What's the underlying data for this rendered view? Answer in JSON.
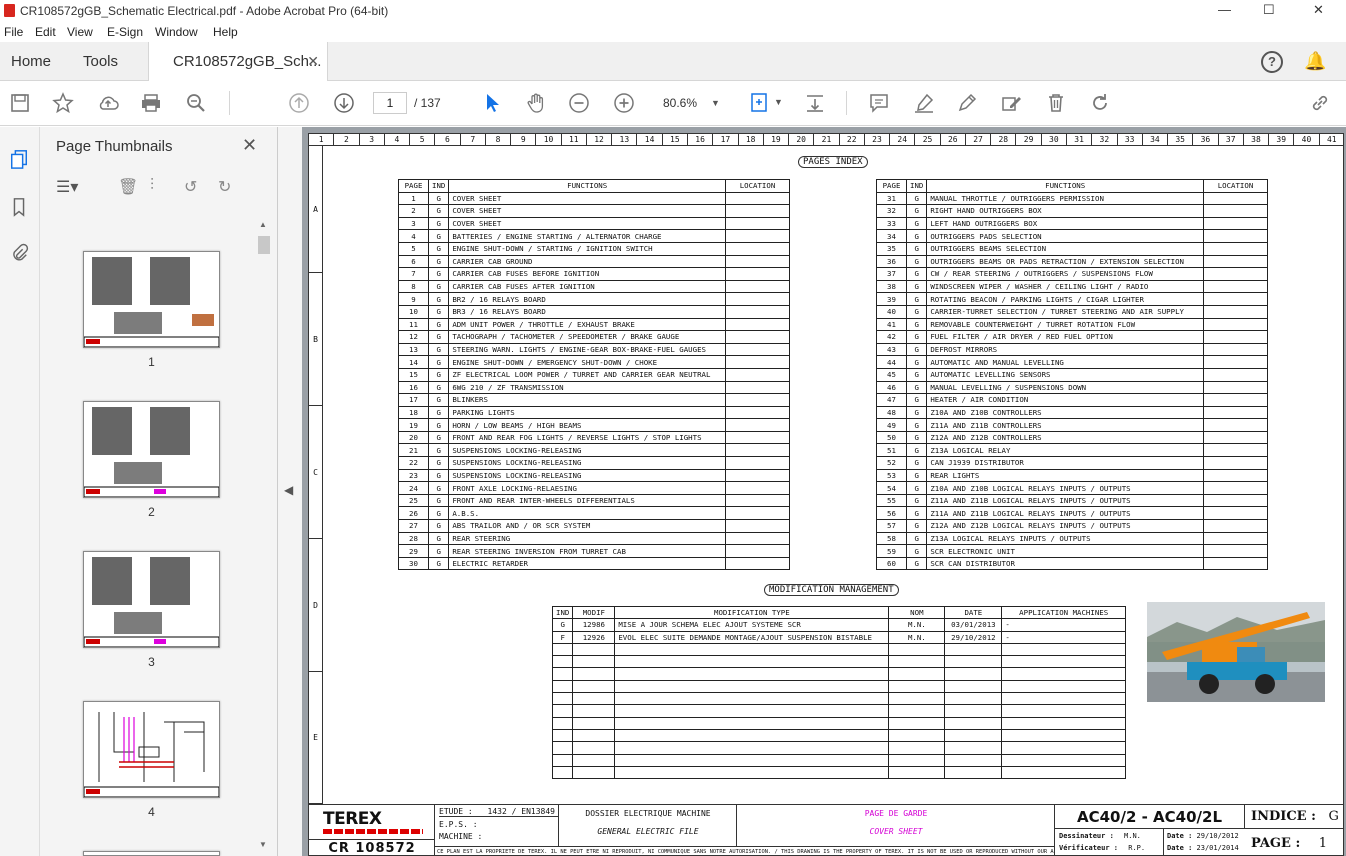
{
  "window": {
    "title": "CR108572gGB_Schematic Electrical.pdf - Adobe Acrobat Pro (64-bit)",
    "controls": [
      "—",
      "☐",
      "✕"
    ]
  },
  "menu": [
    "File",
    "Edit",
    "View",
    "E-Sign",
    "Window",
    "Help"
  ],
  "tabs": {
    "home": "Home",
    "tools": "Tools",
    "doc": "CR108572gGB_Sch...",
    "doc_close": "✕"
  },
  "toolbar": {
    "page_current": "1",
    "page_total": "/ 137",
    "zoom": "80.6%"
  },
  "panel": {
    "title": "Page Thumbnails",
    "close": "✕",
    "thumbs": [
      "1",
      "2",
      "3",
      "4"
    ]
  },
  "sheet": {
    "columns": [
      "1",
      "2",
      "3",
      "4",
      "5",
      "6",
      "7",
      "8",
      "9",
      "10",
      "11",
      "12",
      "13",
      "14",
      "15",
      "16",
      "17",
      "18",
      "19",
      "20",
      "21",
      "22",
      "23",
      "24",
      "25",
      "26",
      "27",
      "28",
      "29",
      "30",
      "31",
      "32",
      "33",
      "34",
      "35",
      "36",
      "37",
      "38",
      "39",
      "40",
      "41"
    ],
    "rows": [
      "A",
      "B",
      "C",
      "D",
      "E"
    ],
    "pages_index_title": "PAGES INDEX",
    "index_headers": {
      "page": "PAGE",
      "ind": "IND",
      "functions": "FUNCTIONS",
      "location": "LOCATION"
    },
    "left_index": [
      [
        "1",
        "G",
        "COVER SHEET"
      ],
      [
        "2",
        "G",
        "COVER SHEET"
      ],
      [
        "3",
        "G",
        "COVER SHEET"
      ],
      [
        "4",
        "G",
        "BATTERIES / ENGINE STARTING / ALTERNATOR CHARGE"
      ],
      [
        "5",
        "G",
        "ENGINE SHUT-DOWN / STARTING / IGNITION SWITCH"
      ],
      [
        "6",
        "G",
        "CARRIER CAB GROUND"
      ],
      [
        "7",
        "G",
        "CARRIER CAB FUSES BEFORE IGNITION"
      ],
      [
        "8",
        "G",
        "CARRIER CAB FUSES AFTER IGNITION"
      ],
      [
        "9",
        "G",
        "BR2 / 16 RELAYS BOARD"
      ],
      [
        "10",
        "G",
        "BR3 / 16 RELAYS BOARD"
      ],
      [
        "11",
        "G",
        "ADM UNIT POWER / THROTTLE / EXHAUST BRAKE"
      ],
      [
        "12",
        "G",
        "TACHOGRAPH / TACHOMETER / SPEEDOMETER / BRAKE GAUGE"
      ],
      [
        "13",
        "G",
        "STEERING WARN. LIGHTS / ENGINE-GEAR BOX-BRAKE-FUEL GAUGES"
      ],
      [
        "14",
        "G",
        "ENGINE SHUT-DOWN / EMERGENCY SHUT-DOWN / CHOKE"
      ],
      [
        "15",
        "G",
        "ZF ELECTRICAL LOOM POWER / TURRET AND CARRIER GEAR NEUTRAL"
      ],
      [
        "16",
        "G",
        "6WG 210 / ZF TRANSMISSION"
      ],
      [
        "17",
        "G",
        "BLINKERS"
      ],
      [
        "18",
        "G",
        "PARKING LIGHTS"
      ],
      [
        "19",
        "G",
        "HORN / LOW BEAMS / HIGH BEAMS"
      ],
      [
        "20",
        "G",
        "FRONT AND REAR FOG LIGHTS / REVERSE LIGHTS / STOP LIGHTS"
      ],
      [
        "21",
        "G",
        "SUSPENSIONS LOCKING-RELEASING"
      ],
      [
        "22",
        "G",
        "SUSPENSIONS LOCKING-RELEASING"
      ],
      [
        "23",
        "G",
        "SUSPENSIONS LOCKING-RELEASING"
      ],
      [
        "24",
        "G",
        "FRONT AXLE LOCKING-RELAESING"
      ],
      [
        "25",
        "G",
        "FRONT AND REAR INTER-WHEELS DIFFERENTIALS"
      ],
      [
        "26",
        "G",
        "A.B.S."
      ],
      [
        "27",
        "G",
        "ABS TRAILOR AND / OR SCR SYSTEM"
      ],
      [
        "28",
        "G",
        "REAR STEERING"
      ],
      [
        "29",
        "G",
        "REAR STEERING INVERSION FROM TURRET CAB"
      ],
      [
        "30",
        "G",
        "ELECTRIC RETARDER"
      ]
    ],
    "right_index": [
      [
        "31",
        "G",
        "MANUAL THROTTLE / OUTRIGGERS PERMISSION"
      ],
      [
        "32",
        "G",
        "RIGHT HAND OUTRIGGERS BOX"
      ],
      [
        "33",
        "G",
        "LEFT HAND OUTRIGGERS BOX"
      ],
      [
        "34",
        "G",
        "OUTRIGGERS PADS SELECTION"
      ],
      [
        "35",
        "G",
        "OUTRIGGERS BEAMS SELECTION"
      ],
      [
        "36",
        "G",
        "OUTRIGGERS BEAMS OR PADS RETRACTION / EXTENSION SELECTION"
      ],
      [
        "37",
        "G",
        "CW / REAR STEERING / OUTRIGGERS / SUSPENSIONS FLOW"
      ],
      [
        "38",
        "G",
        "WINDSCREEN WIPER / WASHER / CEILING LIGHT / RADIO"
      ],
      [
        "39",
        "G",
        "ROTATING BEACON / PARKING LIGHTS / CIGAR LIGHTER"
      ],
      [
        "40",
        "G",
        "CARRIER-TURRET SELECTION / TURRET STEERING AND AIR SUPPLY"
      ],
      [
        "41",
        "G",
        "REMOVABLE COUNTERWEIGHT / TURRET ROTATION FLOW"
      ],
      [
        "42",
        "G",
        "FUEL FILTER / AIR DRYER / RED FUEL OPTION"
      ],
      [
        "43",
        "G",
        "DEFROST MIRRORS"
      ],
      [
        "44",
        "G",
        "AUTOMATIC AND MANUAL LEVELLING"
      ],
      [
        "45",
        "G",
        "AUTOMATIC LEVELLING SENSORS"
      ],
      [
        "46",
        "G",
        "MANUAL LEVELLING / SUSPENSIONS DOWN"
      ],
      [
        "47",
        "G",
        "HEATER / AIR CONDITION"
      ],
      [
        "48",
        "G",
        "Z10A AND Z10B CONTROLLERS"
      ],
      [
        "49",
        "G",
        "Z11A AND Z11B CONTROLLERS"
      ],
      [
        "50",
        "G",
        "Z12A AND Z12B CONTROLLERS"
      ],
      [
        "51",
        "G",
        "Z13A LOGICAL RELAY"
      ],
      [
        "52",
        "G",
        "CAN J1939 DISTRIBUTOR"
      ],
      [
        "53",
        "G",
        "REAR LIGHTS"
      ],
      [
        "54",
        "G",
        "Z10A AND Z10B LOGICAL RELAYS INPUTS / OUTPUTS"
      ],
      [
        "55",
        "G",
        "Z11A AND Z11B LOGICAL RELAYS INPUTS / OUTPUTS"
      ],
      [
        "56",
        "G",
        "Z11A AND Z11B LOGICAL RELAYS INPUTS / OUTPUTS"
      ],
      [
        "57",
        "G",
        "Z12A AND Z12B LOGICAL RELAYS INPUTS / OUTPUTS"
      ],
      [
        "58",
        "G",
        "Z13A LOGICAL RELAYS INPUTS / OUTPUTS"
      ],
      [
        "59",
        "G",
        "SCR ELECTRONIC UNIT"
      ],
      [
        "60",
        "G",
        "SCR CAN DISTRIBUTOR"
      ]
    ],
    "mod_title": "MODIFICATION MANAGEMENT",
    "mod_headers": [
      "IND",
      "MODIF",
      "MODIFICATION TYPE",
      "NOM",
      "DATE",
      "APPLICATION MACHINES"
    ],
    "mod_rows": [
      [
        "G",
        "12986",
        "MISE A JOUR SCHEMA ELEC AJOUT SYSTEME SCR",
        "M.N.",
        "03/01/2013",
        "-"
      ],
      [
        "F",
        "12926",
        "EVOL ELEC SUITE DEMANDE MONTAGE/AJOUT SUSPENSION BISTABLE",
        "M.N.",
        "29/10/2012",
        "-"
      ]
    ],
    "title_block": {
      "brand": "TEREX",
      "cr": "CR 108572",
      "etude_label": "ETUDE :",
      "etude_val": "1432 / EN13849",
      "eps": "E.P.S. :",
      "machine": "MACHINE :",
      "dossier": "DOSSIER ELECTRIQUE MACHINE",
      "general": "GENERAL ELECTRIC FILE",
      "page_garde": "PAGE DE GARDE",
      "cover": "COVER SHEET",
      "model": "AC40/2 - AC40/2L",
      "indice_label": "INDICE :",
      "indice_val": "G",
      "page_label": "PAGE :",
      "page_val": "1",
      "dess_label": "Dessinateur :",
      "dess_val": "M.N.",
      "date1_label": "Date :",
      "date1_val": "29/10/2012",
      "verif_label": "Vérificateur :",
      "verif_val": "R.P.",
      "date2_label": "Date :",
      "date2_val": "23/01/2014",
      "legal": "CE PLAN EST LA PROPRIETE DE TEREX. IL NE PEUT ETRE NI REPRODUIT, NI COMMUNIQUE SANS NOTRE AUTORISATION. / THIS DRAWING IS THE PROPERTY OF TEREX. IT IS NOT BE USED OR REPRODUCED WITHOUT OUR AUTHORISATION."
    }
  }
}
